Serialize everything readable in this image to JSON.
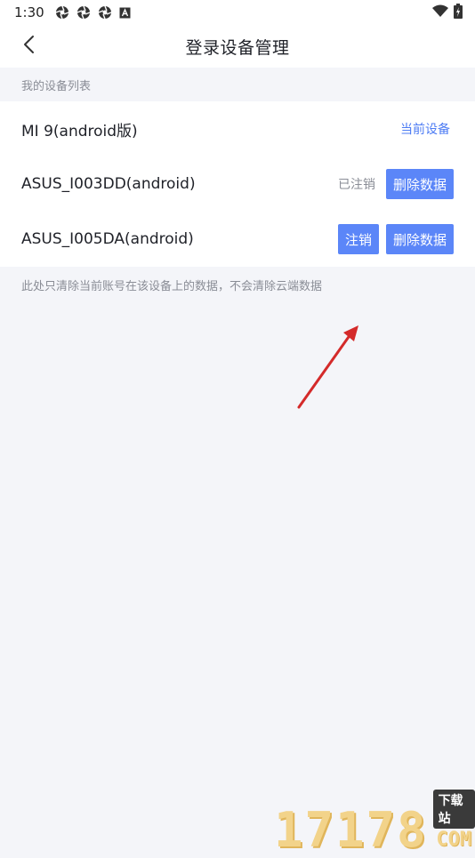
{
  "status_bar": {
    "time": "1:30",
    "left_icons": [
      "aperture-icon",
      "aperture-icon",
      "aperture-icon",
      "a-box-icon"
    ],
    "right_icons": [
      "wifi-icon",
      "battery-charging-icon"
    ]
  },
  "nav": {
    "back_icon": "chevron-left-icon",
    "title": "登录设备管理"
  },
  "section": {
    "header": "我的设备列表"
  },
  "devices": [
    {
      "name": "MI 9(android版)",
      "current_label": "当前设备"
    },
    {
      "name": "ASUS_I003DD(android)",
      "status": "已注销",
      "delete_label": "删除数据"
    },
    {
      "name": "ASUS_I005DA(android)",
      "logout_label": "注销",
      "delete_label": "删除数据"
    }
  ],
  "note": "此处只清除当前账号在该设备上的数据，不会清除云端数据",
  "annotation": {
    "arrow_color": "#d42a2a"
  },
  "watermark": {
    "digits": "17178",
    "badge": "下载站",
    "suffix": "COM"
  },
  "colors": {
    "accent": "#5b86f8",
    "link": "#4d7cf4",
    "background": "#f4f5f9",
    "muted_text": "#8a8d96"
  }
}
